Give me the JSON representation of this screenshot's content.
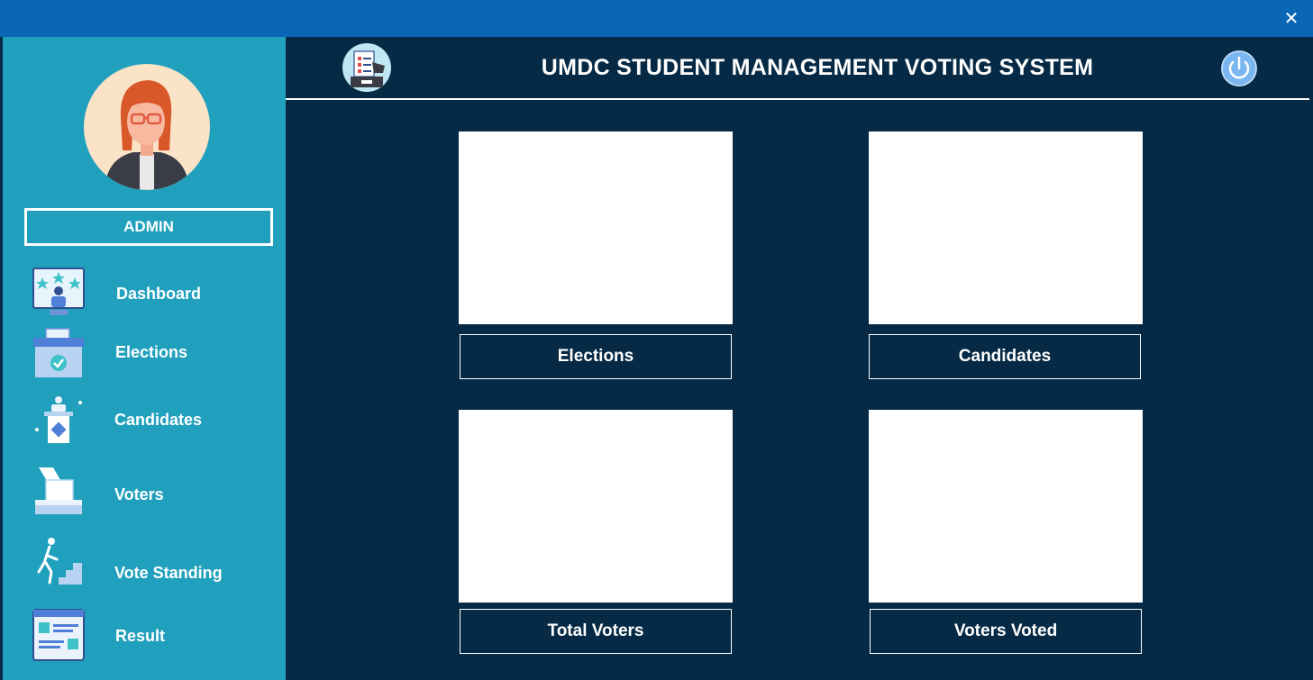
{
  "window": {
    "close_glyph": "✕"
  },
  "header": {
    "title": "UMDC STUDENT MANAGEMENT VOTING SYSTEM"
  },
  "sidebar": {
    "role_label": "ADMIN",
    "items": [
      {
        "label": "Dashboard",
        "icon": "dashboard-icon"
      },
      {
        "label": "Elections",
        "icon": "ballot-box-icon"
      },
      {
        "label": "Candidates",
        "icon": "podium-icon"
      },
      {
        "label": "Voters",
        "icon": "voter-hand-icon"
      },
      {
        "label": "Vote Standing",
        "icon": "stairs-runner-icon"
      },
      {
        "label": "Result",
        "icon": "result-board-icon"
      }
    ]
  },
  "dashboard": {
    "cards": [
      {
        "label": "Elections"
      },
      {
        "label": "Candidates"
      },
      {
        "label": "Total Voters"
      },
      {
        "label": "Voters Voted"
      }
    ]
  },
  "colors": {
    "titlebar": "#0866b4",
    "sidebar": "#21a0bd",
    "main_bg": "#062a45",
    "power_button": "#7ab6ef"
  }
}
